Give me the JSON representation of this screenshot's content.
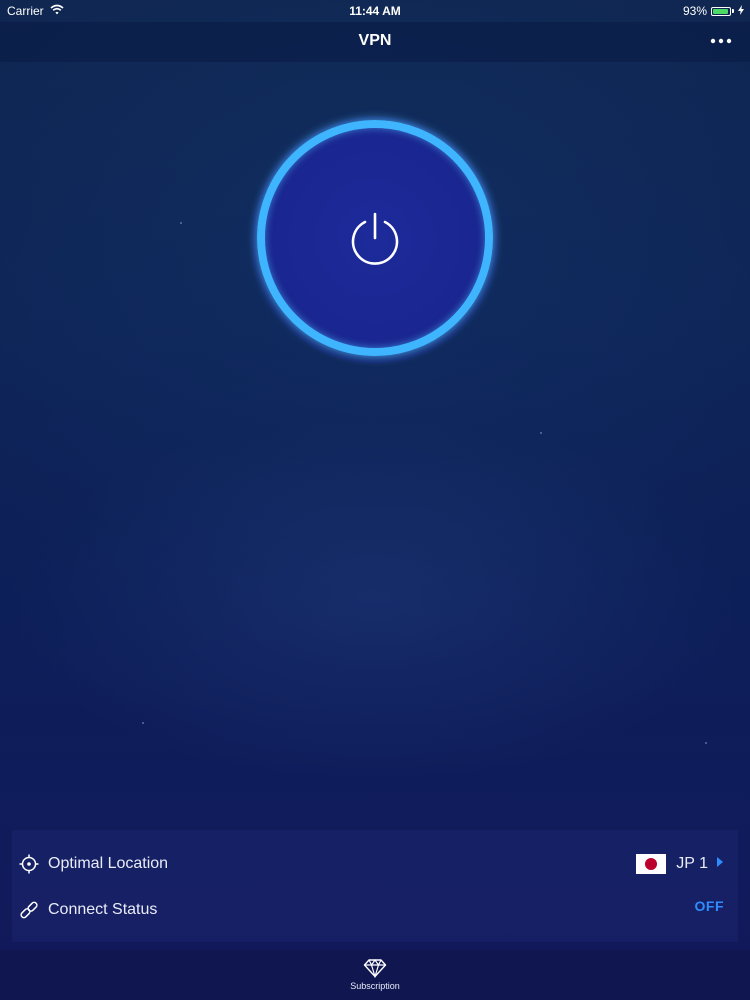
{
  "status_bar": {
    "carrier": "Carrier",
    "time": "11:44 AM",
    "battery_percent": "93%",
    "battery_level": 0.93
  },
  "nav": {
    "title": "VPN"
  },
  "connection": {
    "location_label": "Optimal Location",
    "server_name": "JP 1",
    "status_label": "Connect Status",
    "status_value": "OFF"
  },
  "tabs": [
    {
      "label": "Subscription",
      "icon": "diamond-icon"
    }
  ],
  "colors": {
    "ring": "#3fb5ff",
    "status_off": "#2f8cff",
    "battery": "#4cd964",
    "flag_red": "#bc002d"
  }
}
